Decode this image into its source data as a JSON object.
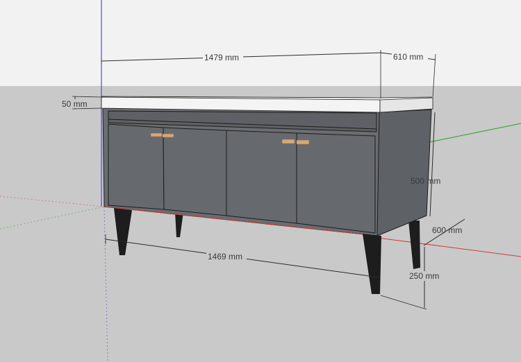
{
  "colors": {
    "sky": "#f2f2f2",
    "ground": "#c9c9c9",
    "carcass": "#6a6d71",
    "carcass_side": "#5e6166",
    "door": "#666a6e",
    "top": "#f4f4f4",
    "edge": "#1b1b1b",
    "handle": "#d6a77a",
    "leg": "#1d1d1d",
    "axis_blue": "#2b2bff",
    "axis_green": "#1fa31f",
    "axis_red": "#d23a3a",
    "dim_line": "#2a2a2a"
  },
  "dimensions": {
    "width_top": "1479 mm",
    "depth_top": "610 mm",
    "top_thickness": "50 mm",
    "cabinet_height": "500 mm",
    "depth_bottom": "600 mm",
    "width_bottom": "1469 mm",
    "leg_height": "250 mm"
  },
  "icons": {
    "handle": "door-handle-icon",
    "leg": "cabinet-leg-icon"
  }
}
